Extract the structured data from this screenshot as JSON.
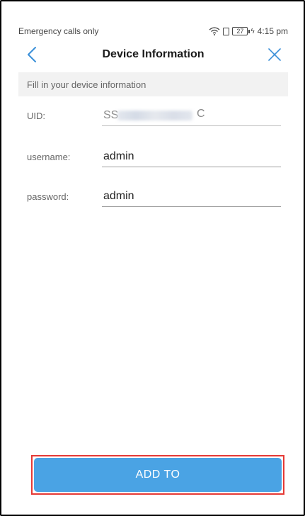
{
  "status_bar": {
    "carrier": "Emergency calls only",
    "battery": "27",
    "time": "4:15 pm"
  },
  "nav": {
    "title": "Device Information",
    "back_icon": "chevron-left-icon",
    "close_icon": "close-icon"
  },
  "section": {
    "header": "Fill in your device information"
  },
  "form": {
    "uid": {
      "label": "UID:",
      "value": "SS",
      "value_tail": "C"
    },
    "username": {
      "label": "username:",
      "value": "admin"
    },
    "password": {
      "label": "password:",
      "value": "admin"
    }
  },
  "button": {
    "add_label": "ADD TO"
  },
  "colors": {
    "accent": "#4aa3e4",
    "highlight": "#e53935",
    "section_bg": "#f2f2f2"
  }
}
